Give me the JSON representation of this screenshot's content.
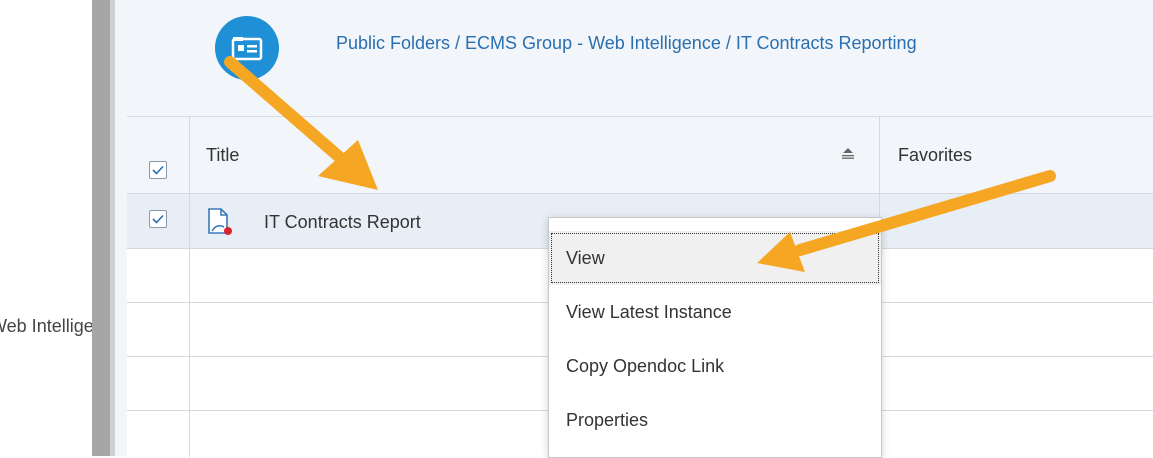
{
  "sidebar": {
    "cut_label": "Web Intelligence"
  },
  "header": {
    "breadcrumb": "Public Folders / ECMS Group - Web Intelligence / IT Contracts Reporting"
  },
  "table": {
    "columns": [
      "Title",
      "Favorites"
    ],
    "rows": [
      {
        "title": "IT Contracts Report",
        "checked": true
      }
    ]
  },
  "context_menu": {
    "items": [
      "View",
      "View Latest Instance",
      "Copy Opendoc Link",
      "Properties"
    ]
  },
  "colors": {
    "accent_blue": "#1f8fd6",
    "link_blue": "#2a6fb0",
    "annotation_arrow": "#f5a623",
    "selection_row": "#e8eef5"
  }
}
